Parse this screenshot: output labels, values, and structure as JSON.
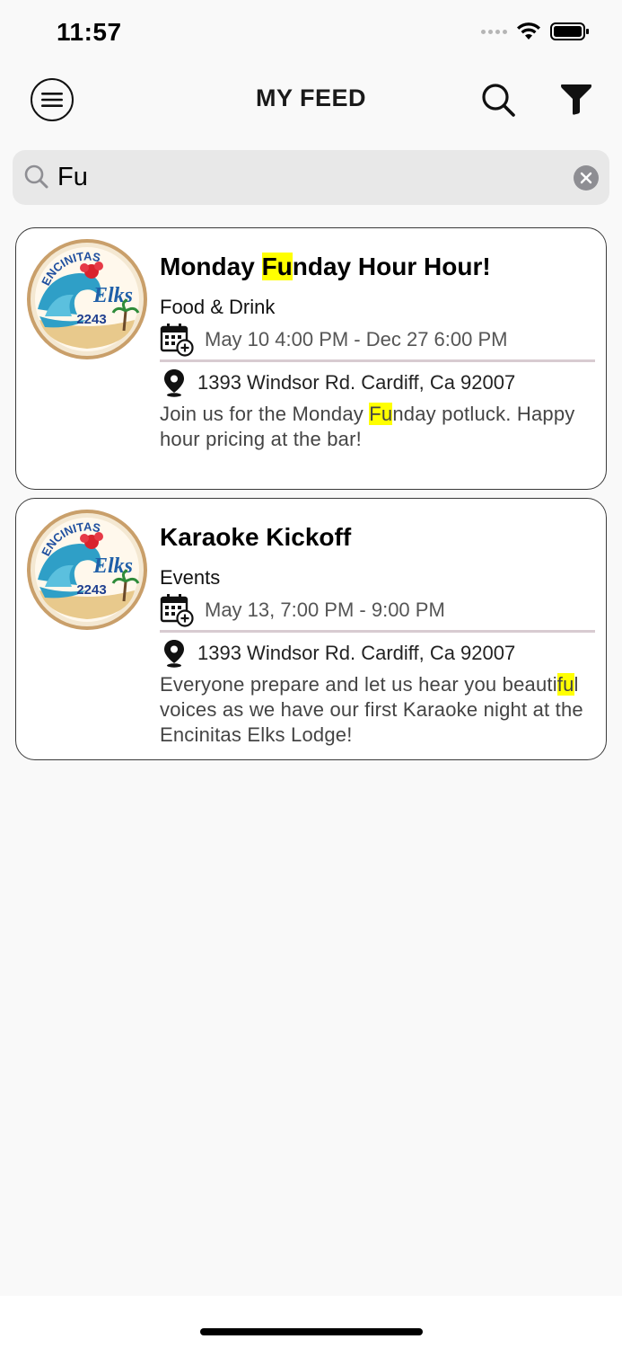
{
  "status_bar": {
    "time": "11:57"
  },
  "nav": {
    "title": "MY FEED"
  },
  "search": {
    "value": "Fu",
    "placeholder": ""
  },
  "events": [
    {
      "logo_text": "ENCINITAS Elks 2243",
      "title_pre": "Monday ",
      "title_hl": "Fu",
      "title_post": "nday Hour Hour!",
      "category": "Food & Drink",
      "dates": "May 10 4:00 PM - Dec 27 6:00 PM",
      "location": "1393 Windsor Rd. Cardiff, Ca 92007",
      "desc_pre": "Join us for the Monday ",
      "desc_hl": "Fu",
      "desc_post": "nday potluck. Happy hour pricing at the bar!"
    },
    {
      "logo_text": "ENCINITAS Elks 2243",
      "title_pre": "Karaoke Kickoff",
      "title_hl": "",
      "title_post": "",
      "category": "Events",
      "dates": "May 13, 7:00 PM - 9:00 PM",
      "location": "1393 Windsor Rd. Cardiff, Ca 92007",
      "desc_pre": "Everyone prepare and let us hear you beauti",
      "desc_hl": "fu",
      "desc_post": "l voices as we have our first Karaoke night at the Encinitas Elks Lodge!"
    }
  ],
  "colors": {
    "highlight": "#ffff00",
    "divider": "#d8cbd1",
    "search_bg": "#e8e8e8"
  },
  "icons": [
    "wifi-icon",
    "battery-icon",
    "menu-icon",
    "search-icon",
    "filter-icon",
    "clear-icon",
    "calendar-add-icon",
    "location-pin-icon"
  ]
}
